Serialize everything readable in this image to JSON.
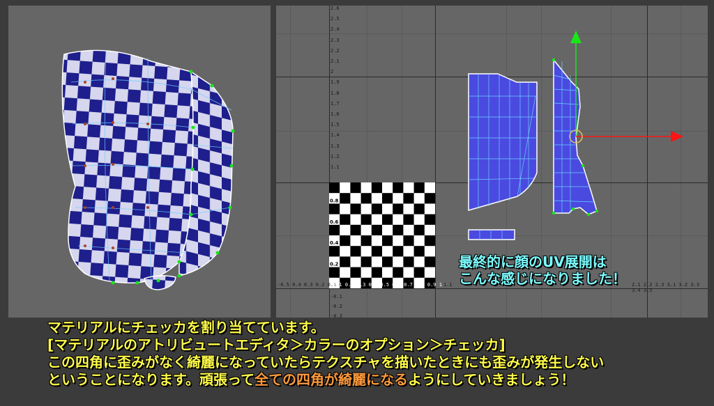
{
  "uv_axis": {
    "y_ticks": [
      "2.6",
      "2.5",
      "2.4",
      "2.3",
      "2.2",
      "2.1",
      "2",
      "1.9",
      "1.8",
      "1.7",
      "1.6",
      "1.5",
      "1.4",
      "1.3",
      "1.2",
      "1.1",
      "-0.1",
      "-0.2",
      "-0.3",
      "-0.4"
    ],
    "x_ticks_left": "-0.5 0.4 0.3 0.2 0.1",
    "x_ticks_middle": "0.1 0.2 0.3 0.4 0.5 0.6 0.7 0.8 0.9 1",
    "x_ticks_right": "1.1",
    "x_ticks_far": "2.1 2.2 2.3   3.1 3.2 3.3 3.4 3.5",
    "checker_ticks": [
      "0.9",
      "0.8",
      "0.7",
      "0.6",
      "0.5",
      "0.4",
      "0.3",
      "0.2",
      "0.1"
    ]
  },
  "uv_note": "最終的に顔のUV展開は\nこんな感じになりました！",
  "caption": {
    "line1": "マテリアルにチェッカを割り当てています。",
    "line2": "[マテリアルのアトリビュートエディタ＞カラーのオプション＞チェッカ]",
    "line3": "この四角に歪みがなく綺麗になっていたらテクスチャを描いたときにも歪みが発生しない",
    "line4_pre": "ということになります。頑張って",
    "line4_highlight": "全ての四角が綺麗になる",
    "line4_post": "ようにしていきましょう！"
  },
  "colors": {
    "checker_blue": "#1e1e8c",
    "checker_light": "#d6d6ee",
    "uv_shell_fill": "#4a4ae0",
    "uv_edge": "#6fd0ff",
    "manip_green": "#19e619",
    "manip_red": "#ff1414",
    "note": "#7cfcff",
    "caption": "#fffb4a",
    "highlight": "#ff9a3c"
  }
}
